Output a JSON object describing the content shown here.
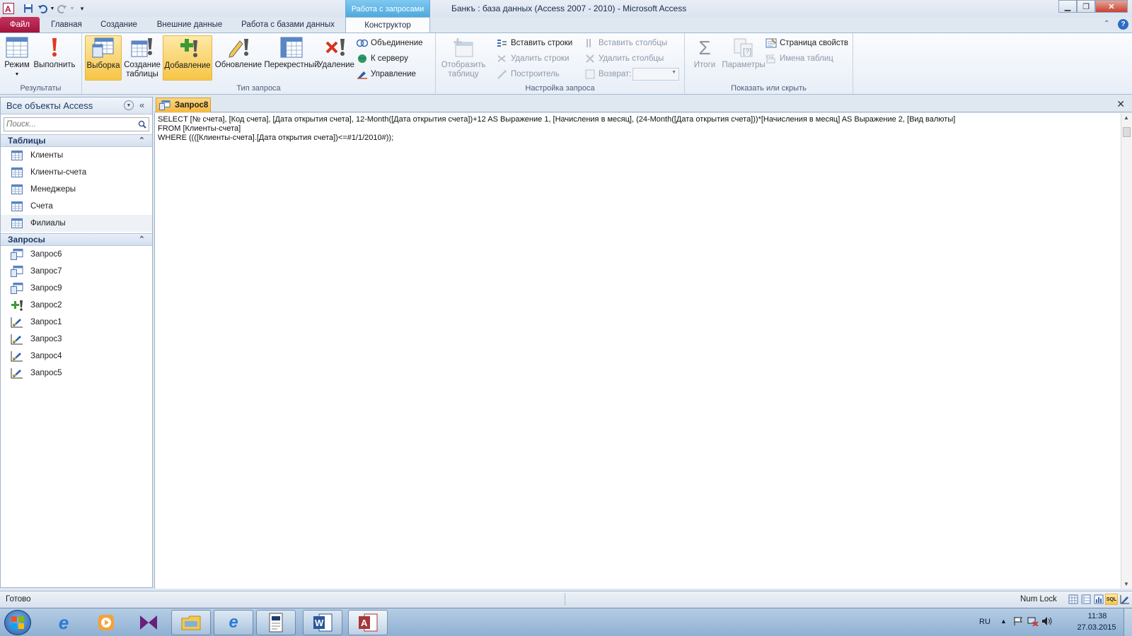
{
  "window": {
    "title": "Банкъ : база данных (Access 2007 - 2010)  -  Microsoft Access",
    "context_group": "Работа с запросами"
  },
  "ribbon_tabs": [
    "Файл",
    "Главная",
    "Создание",
    "Внешние данные",
    "Работа с базами данных",
    "Конструктор"
  ],
  "ribbon": {
    "results": {
      "label": "Результаты",
      "mode": "Режим",
      "run": "Выполнить"
    },
    "query_type": {
      "label": "Тип запроса",
      "select": "Выборка",
      "make_table_1": "Создание",
      "make_table_2": "таблицы",
      "append": "Добавление",
      "update": "Обновление",
      "crosstab": "Перекрестный",
      "delete": "Удаление",
      "union": "Объединение",
      "passthrough": "К серверу",
      "data_definition": "Управление"
    },
    "query_setup": {
      "label": "Настройка запроса",
      "show_table_1": "Отобразить",
      "show_table_2": "таблицу",
      "insert_rows": "Вставить строки",
      "delete_rows": "Удалить строки",
      "builder": "Построитель",
      "insert_cols": "Вставить столбцы",
      "delete_cols": "Удалить столбцы",
      "return": "Возврат:"
    },
    "show_hide": {
      "label": "Показать или скрыть",
      "totals": "Итоги",
      "parameters": "Параметры",
      "property_sheet": "Страница свойств",
      "table_names": "Имена таблиц"
    }
  },
  "nav": {
    "header": "Все объекты Access",
    "search_placeholder": "Поиск...",
    "tables_title": "Таблицы",
    "tables": [
      "Клиенты",
      "Клиенты-счета",
      "Менеджеры",
      "Счета",
      "Филиалы"
    ],
    "queries_title": "Запросы",
    "queries": [
      {
        "name": "Запрос6",
        "icon": "select-query-icon"
      },
      {
        "name": "Запрос7",
        "icon": "select-query-icon"
      },
      {
        "name": "Запрос9",
        "icon": "select-query-icon"
      },
      {
        "name": "Запрос2",
        "icon": "append-query-icon"
      },
      {
        "name": "Запрос1",
        "icon": "update-query-icon"
      },
      {
        "name": "Запрос3",
        "icon": "update-query-icon"
      },
      {
        "name": "Запрос4",
        "icon": "update-query-icon"
      },
      {
        "name": "Запрос5",
        "icon": "update-query-icon"
      }
    ]
  },
  "document": {
    "tab_title": "Запрос8",
    "sql_lines": [
      "SELECT [№ счета], [Код счета], [Дата открытия счета], 12-Month([Дата открытия счета])+12 AS Выражение 1, [Начисления в месяц], (24-Month([Дата открытия счета]))*[Начисления в месяц] AS Выражение 2, [Вид валюты]",
      "FROM [Клиенты-счета]",
      "WHERE ((([Клиенты-счета].[Дата открытия счета])<=#1/1/2010#));"
    ]
  },
  "status": {
    "left": "Готово",
    "numlock": "Num Lock",
    "sql_badge": "SQL"
  },
  "taskbar": {
    "lang": "RU",
    "time": "11:38",
    "date": "27.03.2015"
  },
  "colors": {
    "file_tab": "#b21f4a",
    "context_tab": "#4aa7dc",
    "selected_button": "#f7c546",
    "doc_tab": "#f5b93f"
  }
}
